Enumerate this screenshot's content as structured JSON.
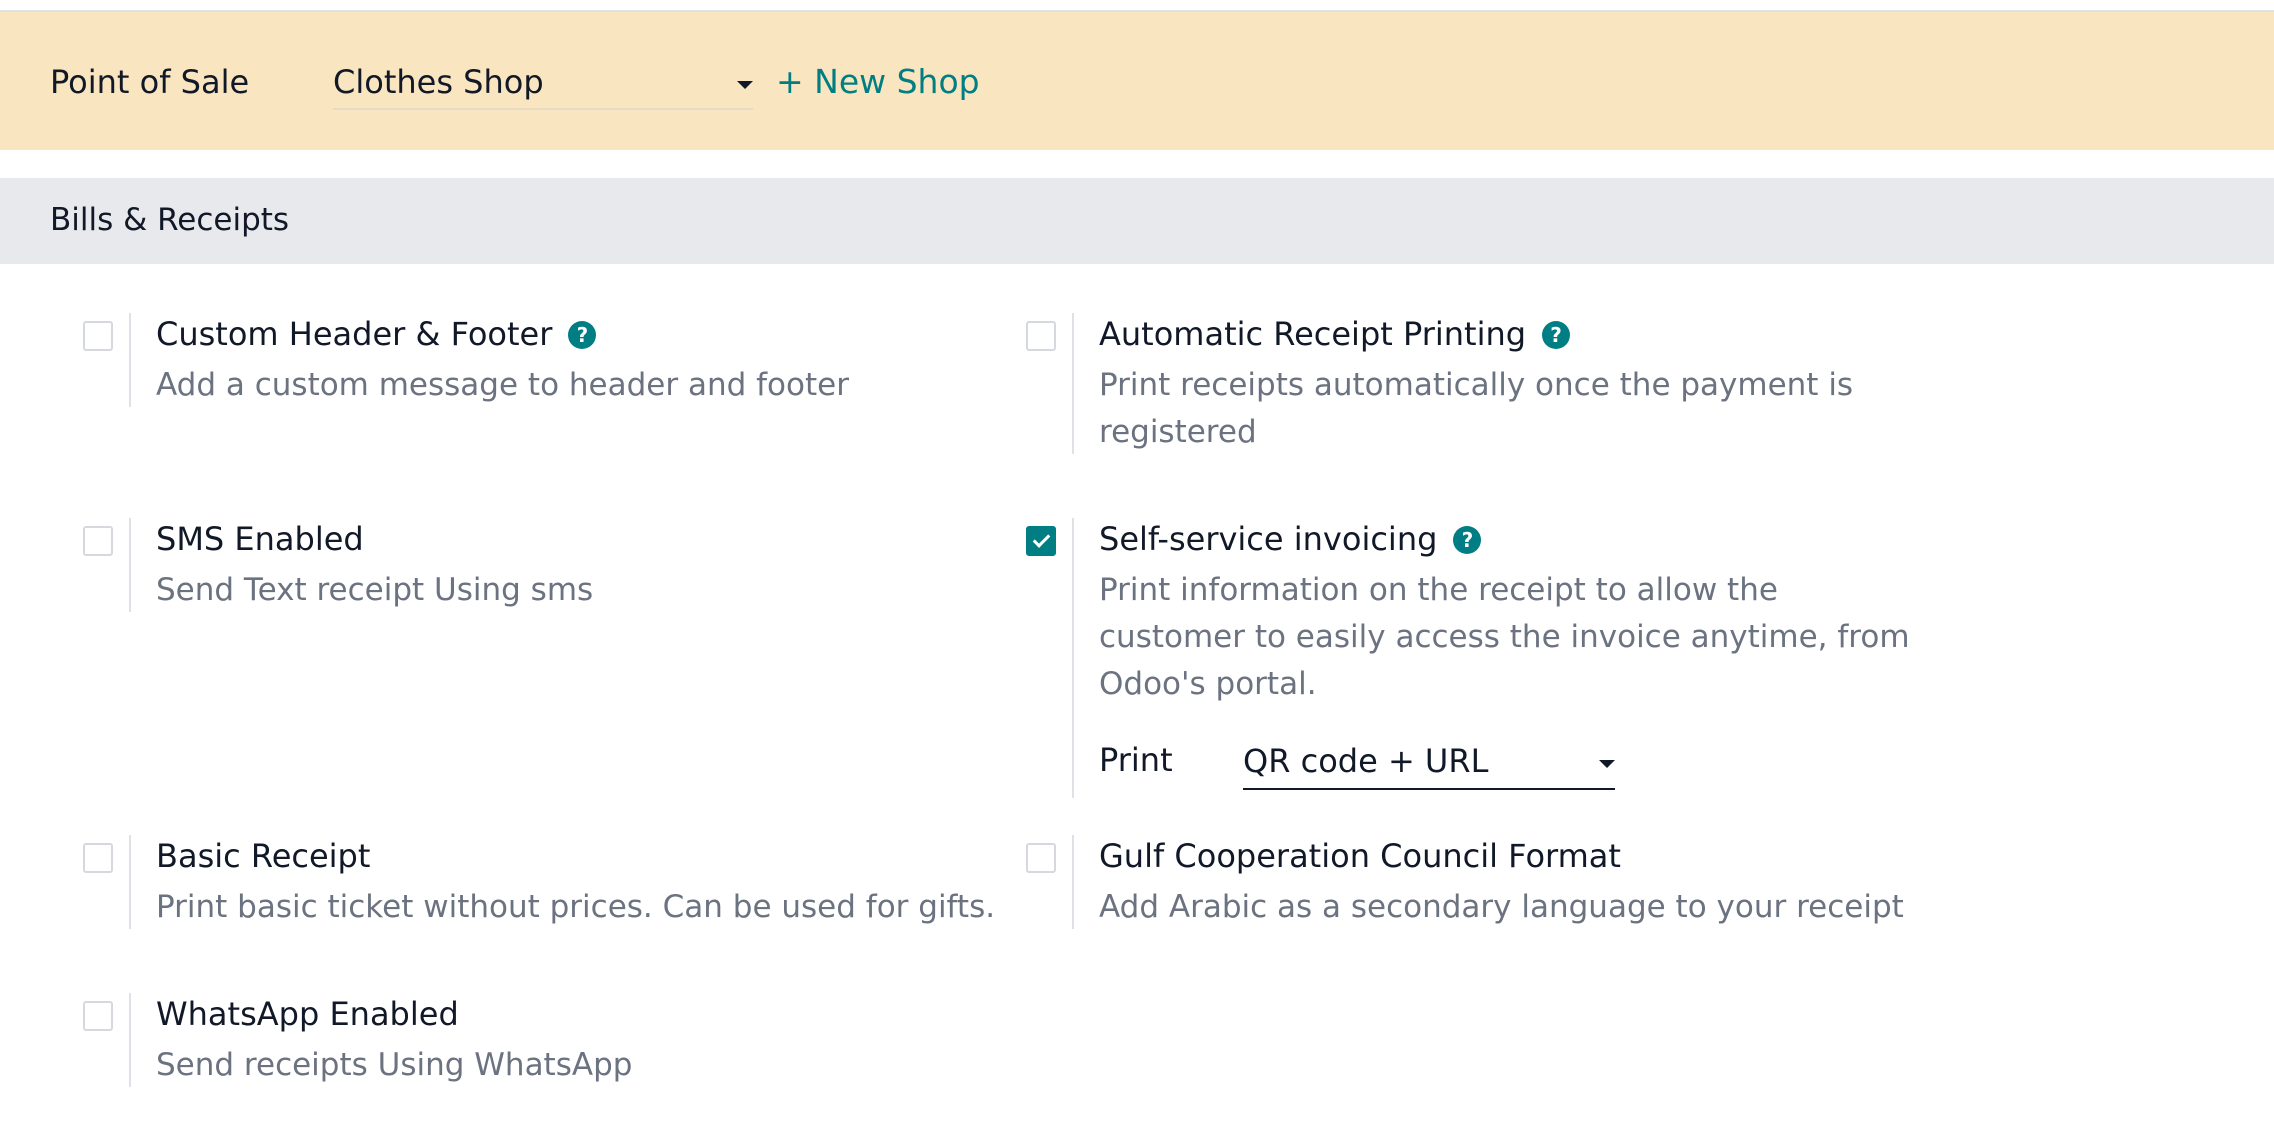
{
  "header": {
    "title": "Point of Sale",
    "shop_select": {
      "value": "Clothes Shop"
    },
    "new_shop_label": "+ New Shop",
    "accent_color": "#017e84",
    "background_color": "#f9e5bf"
  },
  "section": {
    "title": "Bills & Receipts"
  },
  "settings": [
    {
      "title": "Custom Header & Footer",
      "description": "Add a custom message to header and footer",
      "checked": false,
      "has_help_icon": true
    },
    {
      "title": "Automatic Receipt Printing",
      "description": "Print receipts automatically once the payment is registered",
      "checked": false,
      "has_help_icon": true
    },
    {
      "title": "SMS Enabled",
      "description": "Send Text receipt Using sms",
      "checked": false,
      "has_help_icon": false
    },
    {
      "title": "Self-service invoicing",
      "description": "Print information on the receipt to allow the customer to easily access the invoice anytime, from Odoo's portal.",
      "checked": true,
      "has_help_icon": true,
      "print_label": "Print",
      "print_value": "QR code + URL"
    },
    {
      "title": "Basic Receipt",
      "description": "Print basic ticket without prices. Can be used for gifts.",
      "checked": false,
      "has_help_icon": false
    },
    {
      "title": "Gulf Cooperation Council Format",
      "description": "Add Arabic as a secondary language to your receipt",
      "checked": false,
      "has_help_icon": false
    },
    {
      "title": "WhatsApp Enabled",
      "description": "Send receipts Using WhatsApp",
      "checked": false,
      "has_help_icon": false
    }
  ]
}
